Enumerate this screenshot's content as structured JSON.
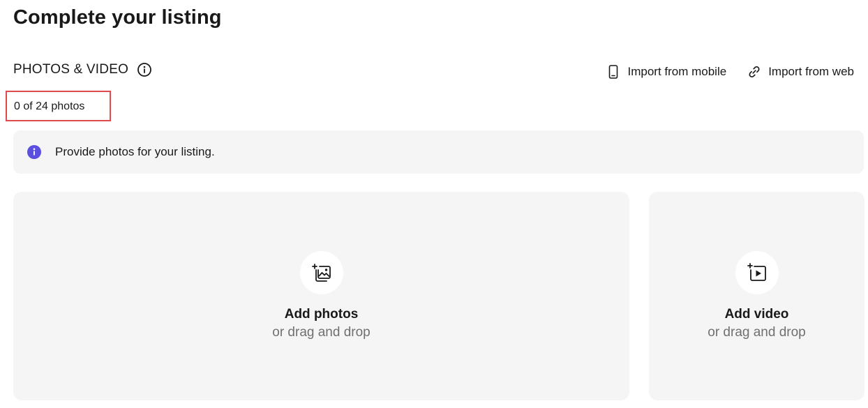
{
  "page": {
    "title": "Complete your listing"
  },
  "section": {
    "title": "PHOTOS & VIDEO",
    "info_icon": "info-circle-icon"
  },
  "imports": [
    {
      "label": "Import from mobile",
      "icon": "mobile-phone-icon"
    },
    {
      "label": "Import from web",
      "icon": "link-icon"
    }
  ],
  "photo_count": {
    "text": "0 of 24 photos",
    "current": 0,
    "max": 24,
    "highlight_color": "#e04a4a"
  },
  "notice": {
    "icon": "info-filled-icon",
    "icon_color": "#5b4fe0",
    "text": "Provide photos for your listing."
  },
  "upload": {
    "photos": {
      "icon": "add-image-icon",
      "title": "Add photos",
      "subtitle": "or drag and drop"
    },
    "video": {
      "icon": "add-video-icon",
      "title": "Add video",
      "subtitle": "or drag and drop"
    }
  }
}
